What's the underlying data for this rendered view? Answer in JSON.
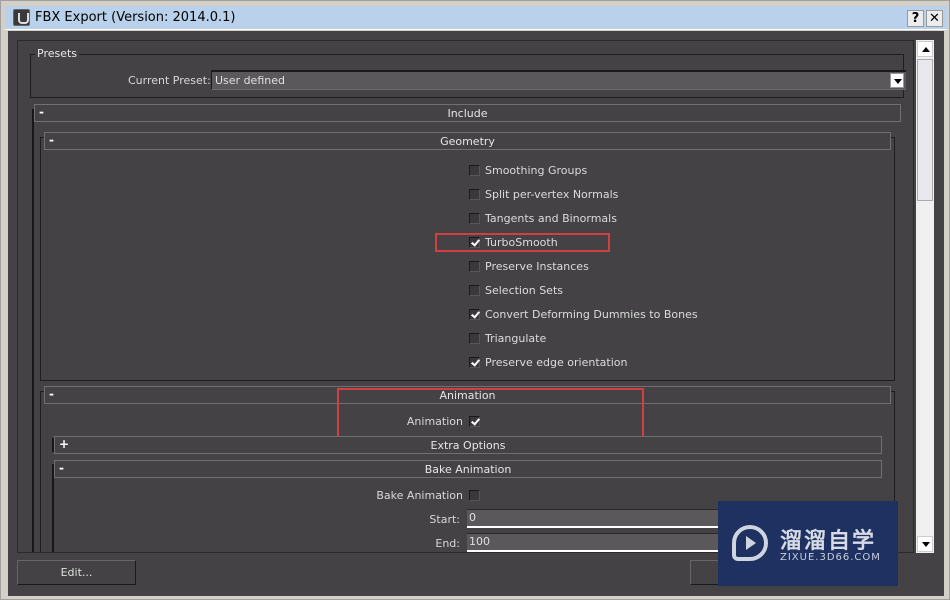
{
  "window": {
    "title": "FBX Export (Version: 2014.0.1)",
    "help_label": "?",
    "close_label": "✕"
  },
  "presets": {
    "group_label": "Presets",
    "current_preset_label": "Current Preset:",
    "current_preset_value": "User defined"
  },
  "rollouts": {
    "include": {
      "title": "Include",
      "toggle": "-"
    },
    "geometry": {
      "title": "Geometry",
      "toggle": "-"
    },
    "animation": {
      "title": "Animation",
      "toggle": "-"
    },
    "extra_options": {
      "title": "Extra Options",
      "toggle": "+"
    },
    "bake_animation": {
      "title": "Bake Animation",
      "toggle": "-"
    }
  },
  "geometry_options": [
    {
      "label": "Smoothing Groups",
      "checked": false
    },
    {
      "label": "Split per-vertex Normals",
      "checked": false
    },
    {
      "label": "Tangents and Binormals",
      "checked": false
    },
    {
      "label": "TurboSmooth",
      "checked": true,
      "highlighted": true
    },
    {
      "label": "Preserve Instances",
      "checked": false
    },
    {
      "label": "Selection Sets",
      "checked": false
    },
    {
      "label": "Convert Deforming Dummies to Bones",
      "checked": true
    },
    {
      "label": "Triangulate",
      "checked": false
    },
    {
      "label": "Preserve edge orientation",
      "checked": true
    }
  ],
  "animation": {
    "label": "Animation",
    "checked": true
  },
  "bake": {
    "label": "Bake Animation",
    "checked": false,
    "start_label": "Start:",
    "start_value": "0",
    "end_label": "End:",
    "end_value": "100"
  },
  "buttons": {
    "edit": "Edit..."
  },
  "watermark": {
    "brand": "溜溜自学",
    "url": "ZIXUE.3D66.COM"
  },
  "colors": {
    "panel_bg": "#444244",
    "titlebar_bg": "#b9d1ea",
    "highlight": "#d04040",
    "watermark_bg": "#1e3160"
  }
}
